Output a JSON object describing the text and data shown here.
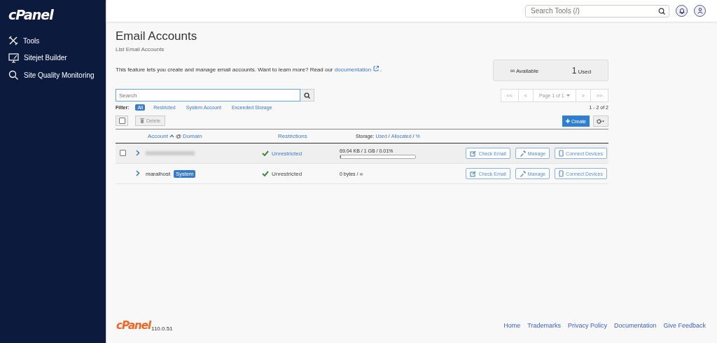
{
  "sidebar": {
    "logo": "cPanel",
    "items": [
      {
        "label": "Tools"
      },
      {
        "label": "Sitejet Builder"
      },
      {
        "label": "Site Quality Monitoring"
      }
    ]
  },
  "topbar": {
    "search": {
      "placeholder": "Search Tools (/)"
    }
  },
  "page": {
    "title": "Email Accounts",
    "subtitle": "List Email Accounts",
    "intro": "This feature lets you create and manage email accounts. Want to learn more? Read our",
    "intro_link": "documentation",
    "intro_end": ".",
    "stats": {
      "infinity": "∞",
      "available": "Available",
      "used_count": "1",
      "used": "Used"
    },
    "search": {
      "placeholder": "Search"
    },
    "filter_label": "Filter:",
    "filters": [
      {
        "label": "All",
        "selected": true
      },
      {
        "label": "Restricted",
        "selected": false
      },
      {
        "label": "System Account",
        "selected": false
      },
      {
        "label": "Exceeded Storage",
        "selected": false
      }
    ],
    "pagination": {
      "first": "<<",
      "prev": "<",
      "page": "Page 1 of 1",
      "next": ">",
      "last": ">>",
      "range": "1 - 2 of 2"
    },
    "select_all": {
      "checked": false
    },
    "delete": "Delete",
    "create": "Create",
    "columns": {
      "account": "Account",
      "at": "@",
      "domain": "Domain",
      "restrictions": "Restrictions",
      "storage": "Storage:",
      "used": "Used",
      "slash": "/",
      "allocated": "Allocated",
      "slash2": "/",
      "percent": "%"
    },
    "rows": [
      {
        "redacted": true,
        "checkbox": {
          "checked": false
        },
        "restriction": "Unrestricted",
        "storage": "69.04 KB / 1 GB / 0.01%",
        "level": 0.0001,
        "highlighted": true,
        "actions": [
          "Check Email",
          "Manage",
          "Connect Devices"
        ]
      },
      {
        "account": "maralhost",
        "badge": "System",
        "restriction": "Unrestricted",
        "storage": "0 bytes / ∞",
        "highlighted": false,
        "actions": [
          "Check Email",
          "Manage",
          "Connect Devices"
        ]
      }
    ]
  },
  "footer": {
    "logo": "cPanel",
    "version": "110.0.51",
    "links": [
      "Home",
      "Trademarks",
      "Privacy Policy",
      "Documentation",
      "Give Feedback"
    ]
  }
}
